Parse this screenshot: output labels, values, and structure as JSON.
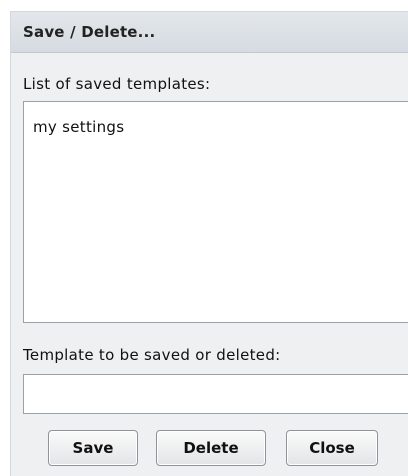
{
  "dialog": {
    "title": "Save / Delete..."
  },
  "templates": {
    "label": "List of saved templates:",
    "items": [
      "my settings"
    ]
  },
  "template_name": {
    "label": "Template to be saved or deleted:",
    "value": "",
    "placeholder": ""
  },
  "buttons": {
    "save": "Save",
    "delete": "Delete",
    "close": "Close"
  }
}
